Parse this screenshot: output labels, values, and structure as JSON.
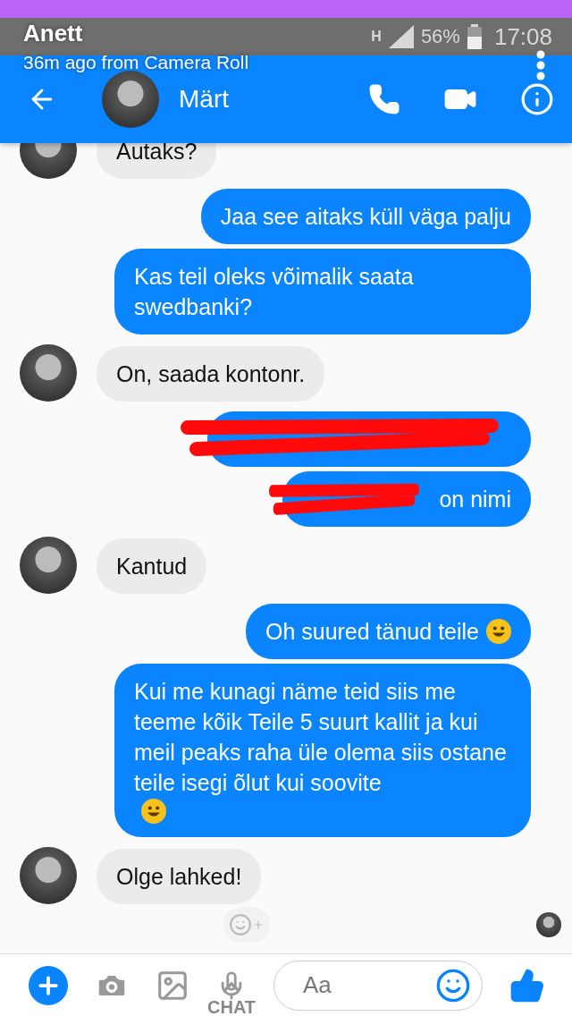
{
  "story": {
    "sender": "Anett",
    "caption": "36m ago from Camera Roll",
    "swipe_label": "CHAT"
  },
  "status_bar": {
    "network": "H",
    "battery": "56%",
    "time": "17:08"
  },
  "header": {
    "contact": "Märt"
  },
  "messages": [
    {
      "outgoing": false,
      "text": "Autaks?",
      "avatar": true
    },
    {
      "outgoing": true,
      "text": "Jaa see aitaks küll väga palju"
    },
    {
      "outgoing": true,
      "text": "Kas teil oleks võimalik saata swedbanki?"
    },
    {
      "outgoing": false,
      "text": "On, saada kontonr.",
      "avatar": true
    },
    {
      "outgoing": true,
      "redacted": true
    },
    {
      "outgoing": true,
      "text": "on nimi",
      "redacted": true
    },
    {
      "outgoing": false,
      "text": "Kantud",
      "avatar": true
    },
    {
      "outgoing": true,
      "text": "Oh suured tänud teile",
      "emoji": true,
      "emoji_own_line": false
    },
    {
      "outgoing": true,
      "text": "Kui me kunagi näme teid siis me teeme kõik Teile 5 suurt kallit ja kui meil peaks raha üle olema siis ostane teile isegi õlut kui soovite",
      "emoji": true,
      "emoji_own_line": true
    },
    {
      "outgoing": false,
      "text": "Olge lahked!",
      "avatar": true
    }
  ],
  "composer": {
    "placeholder": "Aa"
  }
}
